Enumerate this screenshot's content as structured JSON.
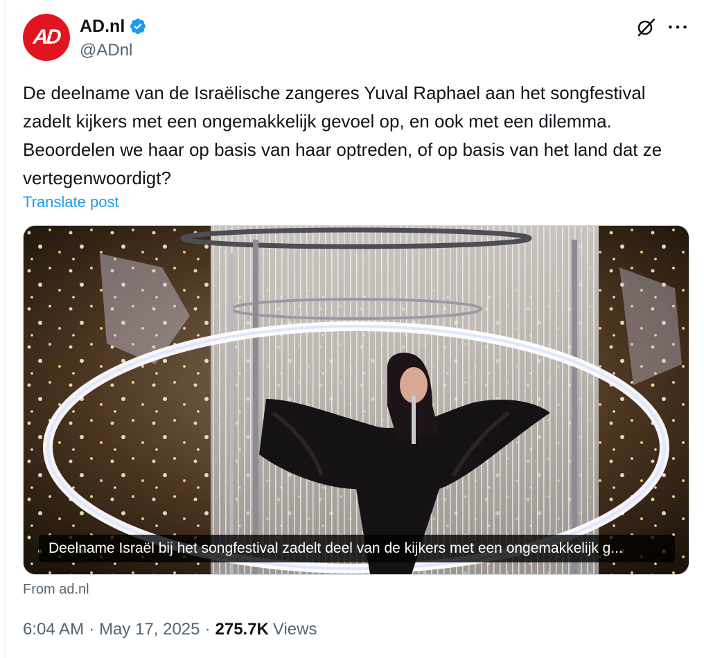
{
  "author": {
    "display_name": "AD.nl",
    "handle": "@ADnl",
    "avatar_text": "AD",
    "verified": true,
    "brand_color": "#e1141f"
  },
  "header_icons": [
    "grok-icon",
    "more-icon"
  ],
  "post": {
    "text": "De deelname van de Israëlische zangeres Yuval Raphael aan het songfestival zadelt kijkers met een ongemakkelijk gevoel op, en ook met een dilemma. Beoordelen we haar op basis van haar optreden, of op basis van het land dat ze vertegenwoordigt?",
    "translate_label": "Translate post"
  },
  "link_card": {
    "caption": "Deelname Israël bij het songfestival zadelt deel van de kijkers met een ongemakkelijk g...",
    "source": "From ad.nl"
  },
  "meta": {
    "time": "6:04 AM",
    "date": "May 17, 2025",
    "separator": "·",
    "views_count": "275.7K",
    "views_label": "Views"
  },
  "colors": {
    "link": "#1d9bf0",
    "secondary_text": "#536471",
    "primary_text": "#0f1419",
    "verified_badge": "#1d9bf0"
  }
}
